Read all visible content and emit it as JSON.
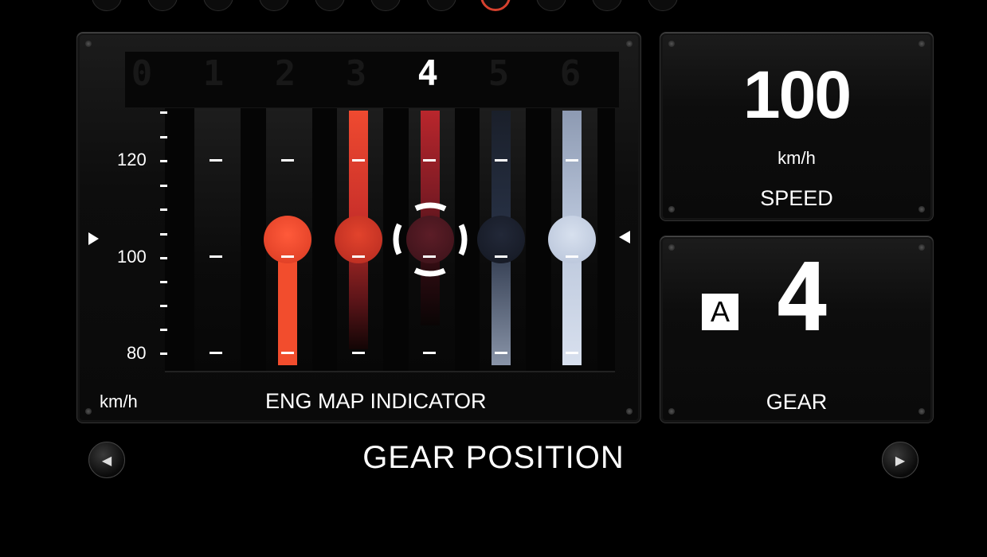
{
  "engine_map": {
    "title": "ENG MAP INDICATOR",
    "unit": "km/h",
    "gear_numbers": [
      "0",
      "1",
      "2",
      "3",
      "4",
      "5",
      "6"
    ],
    "active_gear_index": 4,
    "scale_labels": [
      "120",
      "100",
      "80"
    ]
  },
  "speed": {
    "value": "100",
    "unit": "km/h",
    "label": "SPEED"
  },
  "gear": {
    "mode": "A",
    "value": "4",
    "label": "GEAR"
  },
  "footer": {
    "title": "GEAR POSITION"
  },
  "colors": {
    "accent_red": "#f24d2d",
    "deep_red": "#b3242a",
    "dark_red": "#5a1a22",
    "navy": "#1d2330",
    "pale_blue": "#c7d3e6"
  },
  "icons": {
    "left_arrow": "triangle-left-icon",
    "right_arrow": "triangle-right-icon"
  }
}
